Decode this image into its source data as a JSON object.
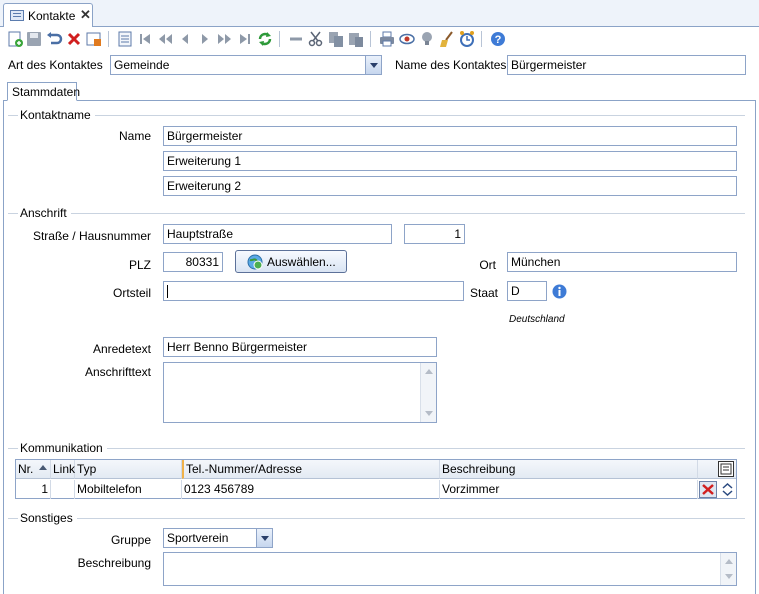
{
  "tabs": {
    "active_label": "Kontakte"
  },
  "header": {
    "art_label": "Art des Kontaktes",
    "art_value": "Gemeinde",
    "name_label": "Name des Kontaktes",
    "name_value": "Bürgermeister"
  },
  "inner_tab": "Stammdaten",
  "kontaktname": {
    "section": "Kontaktname",
    "name_label": "Name",
    "name_value": "Bürgermeister",
    "ext1": "Erweiterung 1",
    "ext2": "Erweiterung 2"
  },
  "anschrift": {
    "section": "Anschrift",
    "strasse_label": "Straße / Hausnummer",
    "strasse": "Hauptstraße",
    "hausnummer": "1",
    "plz_label": "PLZ",
    "plz": "80331",
    "select_button": "Auswählen...",
    "ort_label": "Ort",
    "ort": "München",
    "ortsteil_label": "Ortsteil",
    "ortsteil": "",
    "staat_label": "Staat",
    "staat": "D",
    "staat_name": "Deutschland",
    "anredetext_label": "Anredetext",
    "anredetext": "Herr Benno Bürgermeister",
    "anschrifttext_label": "Anschrifttext",
    "anschrifttext": ""
  },
  "kommunikation": {
    "section": "Kommunikation",
    "columns": [
      "Nr.",
      "Link",
      "Typ",
      "Tel.-Nummer/Adresse",
      "Beschreibung"
    ],
    "rows": [
      {
        "nr": "1",
        "link": "",
        "typ": "Mobiltelefon",
        "nummer": "0123 456789",
        "beschreibung": "Vorzimmer"
      }
    ]
  },
  "sonstiges": {
    "section": "Sonstiges",
    "gruppe_label": "Gruppe",
    "gruppe": "Sportverein",
    "beschreibung_label": "Beschreibung",
    "beschreibung": ""
  },
  "colors": {
    "accent_border": "#8ea4c8",
    "delete_red": "#d11f1f"
  }
}
